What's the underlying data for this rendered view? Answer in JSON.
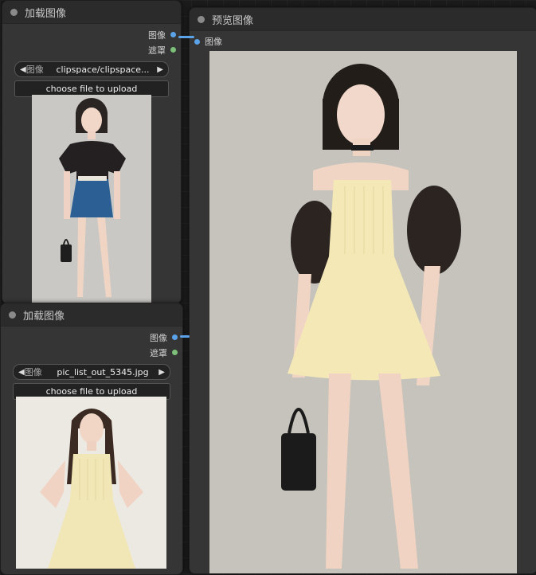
{
  "node_load_1": {
    "title": "加载图像",
    "outputs": [
      {
        "label": "图像"
      },
      {
        "label": "遮罩"
      }
    ],
    "combo": {
      "label": "图像",
      "value": "clipspace/clipspace..."
    },
    "upload_label": "choose file to upload"
  },
  "node_load_2": {
    "title": "加载图像",
    "outputs": [
      {
        "label": "图像"
      },
      {
        "label": "遮罩"
      }
    ],
    "combo": {
      "label": "图像",
      "value": "pic_list_out_5345.jpg"
    },
    "upload_label": "choose file to upload"
  },
  "node_preview": {
    "title": "预览图像",
    "input": {
      "label": "图像"
    }
  },
  "colors": {
    "image_socket": "#5aa3e8",
    "mask_socket": "#7cc07a"
  }
}
